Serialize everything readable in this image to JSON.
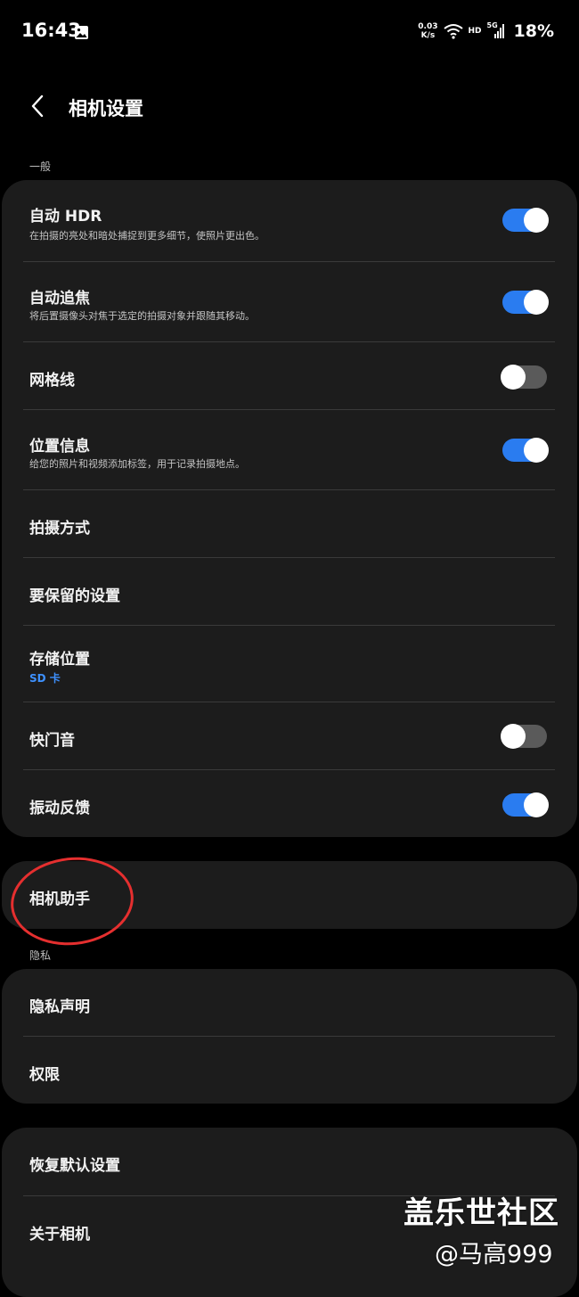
{
  "status_bar": {
    "time": "16:43",
    "net_speed_value": "0.03",
    "net_speed_unit": "K/s",
    "hd": "HD",
    "signal": "5G",
    "battery": "18%"
  },
  "header": {
    "title": "相机设置"
  },
  "sections": {
    "general_label": "一般",
    "privacy_label": "隐私"
  },
  "general_items": [
    {
      "title": "自动 HDR",
      "subtitle": "在拍摄的亮处和暗处捕捉到更多细节，使照片更出色。",
      "toggle": "on"
    },
    {
      "title": "自动追焦",
      "subtitle": "将后置摄像头对焦于选定的拍摄对象并跟随其移动。",
      "toggle": "on"
    },
    {
      "title": "网格线",
      "toggle": "off"
    },
    {
      "title": "位置信息",
      "subtitle": "给您的照片和视频添加标签，用于记录拍摄地点。",
      "toggle": "on"
    },
    {
      "title": "拍摄方式"
    },
    {
      "title": "要保留的设置"
    },
    {
      "title": "存储位置",
      "subtitle": "SD 卡"
    },
    {
      "title": "快门音",
      "toggle": "off"
    },
    {
      "title": "振动反馈",
      "toggle": "on"
    }
  ],
  "assistant": {
    "title": "相机助手"
  },
  "privacy_items": [
    {
      "title": "隐私声明"
    },
    {
      "title": "权限"
    }
  ],
  "other_items": [
    {
      "title": "恢复默认设置"
    },
    {
      "title": "关于相机"
    }
  ],
  "watermark": {
    "line1": "盖乐世社区",
    "line2": "@马高999"
  },
  "colors": {
    "background": "#000000",
    "card": "#1c1c1c",
    "accent": "#2a7cf0",
    "toggle_off": "#5a5a5a",
    "annotation": "#e52f2f",
    "link_blue": "#3e91ff"
  }
}
